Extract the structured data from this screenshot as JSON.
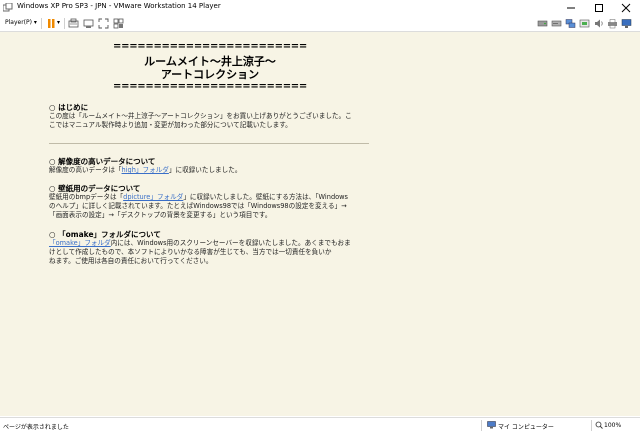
{
  "window": {
    "title": "Windows XP Pro SP3 - JPN - VMware Workstation 14 Player"
  },
  "toolbar": {
    "player_menu": "Player(P) ▾",
    "pause_dropdown": "▾"
  },
  "document": {
    "rule": "========================",
    "title_line1": "ルームメイト～井上涼子～",
    "title_line2": "アートコレクション",
    "sections": {
      "intro": {
        "title": "○ はじめに",
        "line1": "この度は「ルームメイト～井上涼子～アートコレクション」をお買い上げありがとうございました。こ",
        "line2": "こではマニュアル製作時より追加・変更が加わった部分について記載いたします。"
      },
      "hires": {
        "title": "○ 解像度の高いデータについて",
        "text_before": "解像度の高いデータは「",
        "link": "high」フォルダ",
        "text_after": "」に収録いたしました。"
      },
      "wallpaper": {
        "title": "○ 壁紙用のデータについて",
        "text_before": "壁紙用のbmpデータは「",
        "link": "dpicture」フォルダ",
        "text_after": "」に収録いたしました。壁紙にする方法は、「Windows",
        "line2": "のヘルプ」に詳しく記載されています。たとえばWindows98では「Windows98の設定を変える」→",
        "line3": "「画面表示の設定」→「デスクトップの背景を変更する」という項目です。"
      },
      "omake": {
        "title": "○ 「omake」フォルダについて",
        "link": "「omake」フォルダ",
        "text_after": "内には、Windows用のスクリーンセーバーを収録いたしました。あくまでもおま",
        "line2": "けとして作成したもので、本ソフトによりいかなる障害が生じても、当方では一切責任を負いか",
        "line3": "ねます。ご使用は各自の責任において行ってください。"
      }
    }
  },
  "statusbar": {
    "left": "ページが表示されました",
    "zone": "マイ コンピューター",
    "zoom": "100%"
  },
  "colors": {
    "page_background": "#f7f4e5",
    "link": "#3a6fc8",
    "pause_icon": "#f08a00"
  }
}
